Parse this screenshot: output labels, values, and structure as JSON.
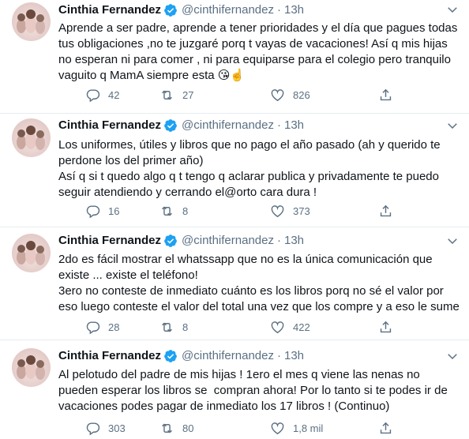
{
  "tweets": [
    {
      "name": "Cinthia Fernandez",
      "handle": "@cinthifernandez",
      "sep": "·",
      "time": "13h",
      "text": "Aprende a ser padre, aprende a tener prioridades y el día que pagues todas tus obligaciones ,no te juzgaré porq t vayas de vacaciones! Así q mis hijas no esperan ni para comer , ni para equiparse para el colegio pero tranquilo vaguito q MamA siempre esta 😘☝️",
      "replies": "42",
      "retweets": "27",
      "likes": "826"
    },
    {
      "name": "Cinthia Fernandez",
      "handle": "@cinthifernandez",
      "sep": "·",
      "time": "13h",
      "text": "Los uniformes, útiles y libros que no pago el año pasado (ah y querido te perdone los del primer año)\nAsí q si t quedo algo q t tengo q aclarar publica y privadamente te puedo seguir atendiendo y cerrando el@orto cara dura !",
      "replies": "16",
      "retweets": "8",
      "likes": "373"
    },
    {
      "name": "Cinthia Fernandez",
      "handle": "@cinthifernandez",
      "sep": "·",
      "time": "13h",
      "text": "2do es fácil mostrar el whatssapp que no es la única comunicación que existe ... existe el teléfono!\n3ero no conteste de inmediato cuánto es los libros porq no sé el valor por eso luego conteste el valor del total una vez que los compre y a eso le sume",
      "replies": "28",
      "retweets": "8",
      "likes": "422"
    },
    {
      "name": "Cinthia Fernandez",
      "handle": "@cinthifernandez",
      "sep": "·",
      "time": "13h",
      "text": "Al pelotudo del padre de mis hijas ! 1ero el mes q viene las nenas no pueden esperar los libros se  compran ahora! Por lo tanto si te podes ir de vacaciones podes pagar de inmediato los 17 libros ! (Continuo)",
      "replies": "303",
      "retweets": "80",
      "likes": "1,8 mil"
    }
  ],
  "colors": {
    "text": "#0f1419",
    "secondary": "#5b7083",
    "verified": "#1da1f2",
    "divider": "#e6ecf0"
  },
  "icons": [
    "verified-badge-icon",
    "more-icon",
    "reply-icon",
    "retweet-icon",
    "like-icon",
    "share-icon"
  ]
}
